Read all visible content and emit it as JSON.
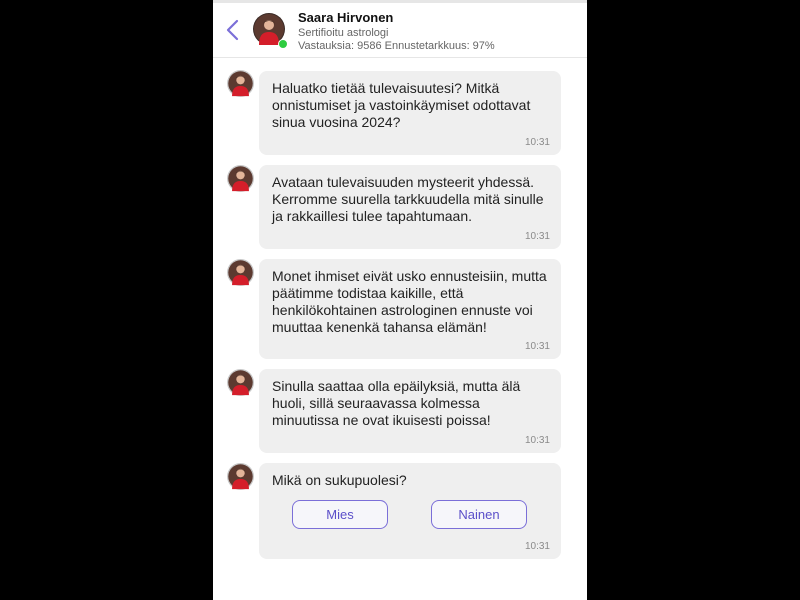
{
  "header": {
    "name": "Saara Hirvonen",
    "title": "Sertifioitu astrologi",
    "stats": "Vastauksia: 9586 Ennustetarkkuus: 97%",
    "accent_color": "#7b6fd8",
    "online_color": "#2ecc40"
  },
  "messages": [
    {
      "text": "Haluatko tietää tulevaisuutesi? Mitkä onnistumiset ja vastoinkäymiset odottavat sinua vuosina 2024?",
      "time": "10:31"
    },
    {
      "text": "Avataan tulevaisuuden mysteerit yhdessä. Kerromme suurella tarkkuudella mitä sinulle ja rakkaillesi tulee tapahtumaan.",
      "time": "10:31"
    },
    {
      "text": "Monet ihmiset eivät usko ennusteisiin, mutta päätimme todistaa kaikille, että henkilökohtainen astrologinen ennuste voi muuttaa kenenkä tahansa elämän!",
      "time": "10:31"
    },
    {
      "text": "Sinulla saattaa olla epäilyksiä, mutta älä huoli, sillä seuraavassa kolmessa minuutissa ne ovat ikuisesti poissa!",
      "time": "10:31"
    },
    {
      "text": "Mikä on sukupuolesi?",
      "time": "10:31",
      "options": [
        "Mies",
        "Nainen"
      ]
    }
  ]
}
